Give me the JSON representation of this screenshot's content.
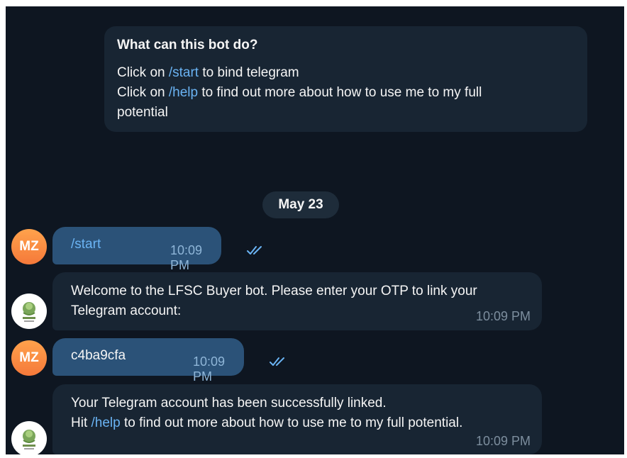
{
  "info": {
    "title": "What can this bot do?",
    "line1_pre": "Click on ",
    "line1_link": "/start",
    "line1_post": " to bind telegram",
    "line2_pre": "Click on ",
    "line2_link": "/help",
    "line2_post": " to find out more about how to use me to my full",
    "line3": "potential"
  },
  "date_separator": "May 23",
  "user": {
    "initials": "MZ"
  },
  "messages": [
    {
      "text": "/start",
      "time": "10:09 PM"
    },
    {
      "line1": "Welcome to the LFSC Buyer bot. Please enter your OTP to link your",
      "line2": "Telegram account:",
      "time": "10:09 PM"
    },
    {
      "text": "c4ba9cfa",
      "time": "10:09 PM"
    },
    {
      "line1": "Your Telegram account has been successfully linked.",
      "line2_pre": "Hit ",
      "line2_link": "/help",
      "line2_post": " to find out more about how to use me to my full potential.",
      "time": "10:09 PM"
    }
  ],
  "colors": {
    "background": "#0e1621",
    "incoming": "#182533",
    "outgoing": "#2b5278",
    "link": "#6ab3f3",
    "avatar": "#f5793a"
  },
  "icons": {
    "read_receipt": "double-check-icon",
    "bot_avatar": "bot-logo-icon"
  }
}
